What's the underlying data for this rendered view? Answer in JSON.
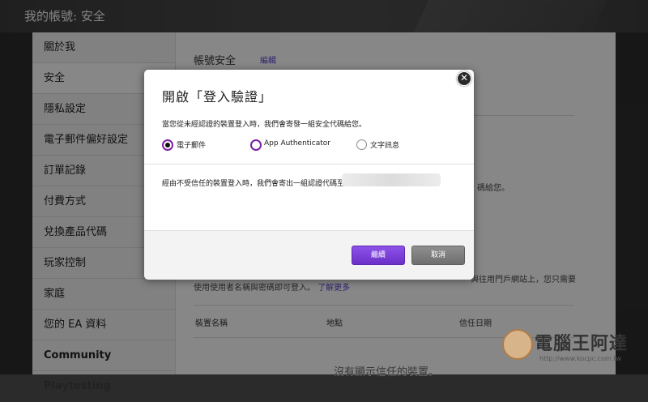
{
  "page": {
    "title": "我的帳號: 安全"
  },
  "sidebar": {
    "items": [
      {
        "label": "關於我"
      },
      {
        "label": "安全"
      },
      {
        "label": "隱私設定"
      },
      {
        "label": "電子郵件偏好設定"
      },
      {
        "label": "訂單記錄"
      },
      {
        "label": "付費方式"
      },
      {
        "label": "兌換產品代碼"
      },
      {
        "label": "玩家控制"
      },
      {
        "label": "家庭"
      },
      {
        "label": "您的 EA 資料"
      },
      {
        "label": "Community Playtesting"
      }
    ]
  },
  "content": {
    "section_title": "帳號安全",
    "edit_label": "編輯",
    "partial_text_1": "碼給您。",
    "partial_text_2": "與往用門戶網站上，您只需要",
    "partial_text_3": "使用使用者名稱與密碼即可登入。",
    "learn_more": "了解更多",
    "table_headers": [
      "裝置名稱",
      "地點",
      "信任日期"
    ],
    "empty_text": "沒有顯示信任的裝置。"
  },
  "modal": {
    "title": "開啟「登入驗證」",
    "description": "當您從未經認證的裝置登入時，我們會寄發一組安全代碼給您。",
    "options": [
      {
        "label": "電子郵件",
        "selected": true
      },
      {
        "label": "App Authenticator",
        "selected": false
      },
      {
        "label": "文字訊息",
        "selected": false
      }
    ],
    "untrusted_text": "經由不受信任的裝置登入時，我們會寄出一組認證代碼至",
    "primary_button": "繼續",
    "cancel_button": "取消"
  },
  "watermark": {
    "text": "電腦王阿達",
    "url": "http://www.kocpc.com.tw"
  },
  "colors": {
    "accent": "#7b1fa2",
    "primary_button": "#7a40d8",
    "link": "#5a3fc8"
  }
}
